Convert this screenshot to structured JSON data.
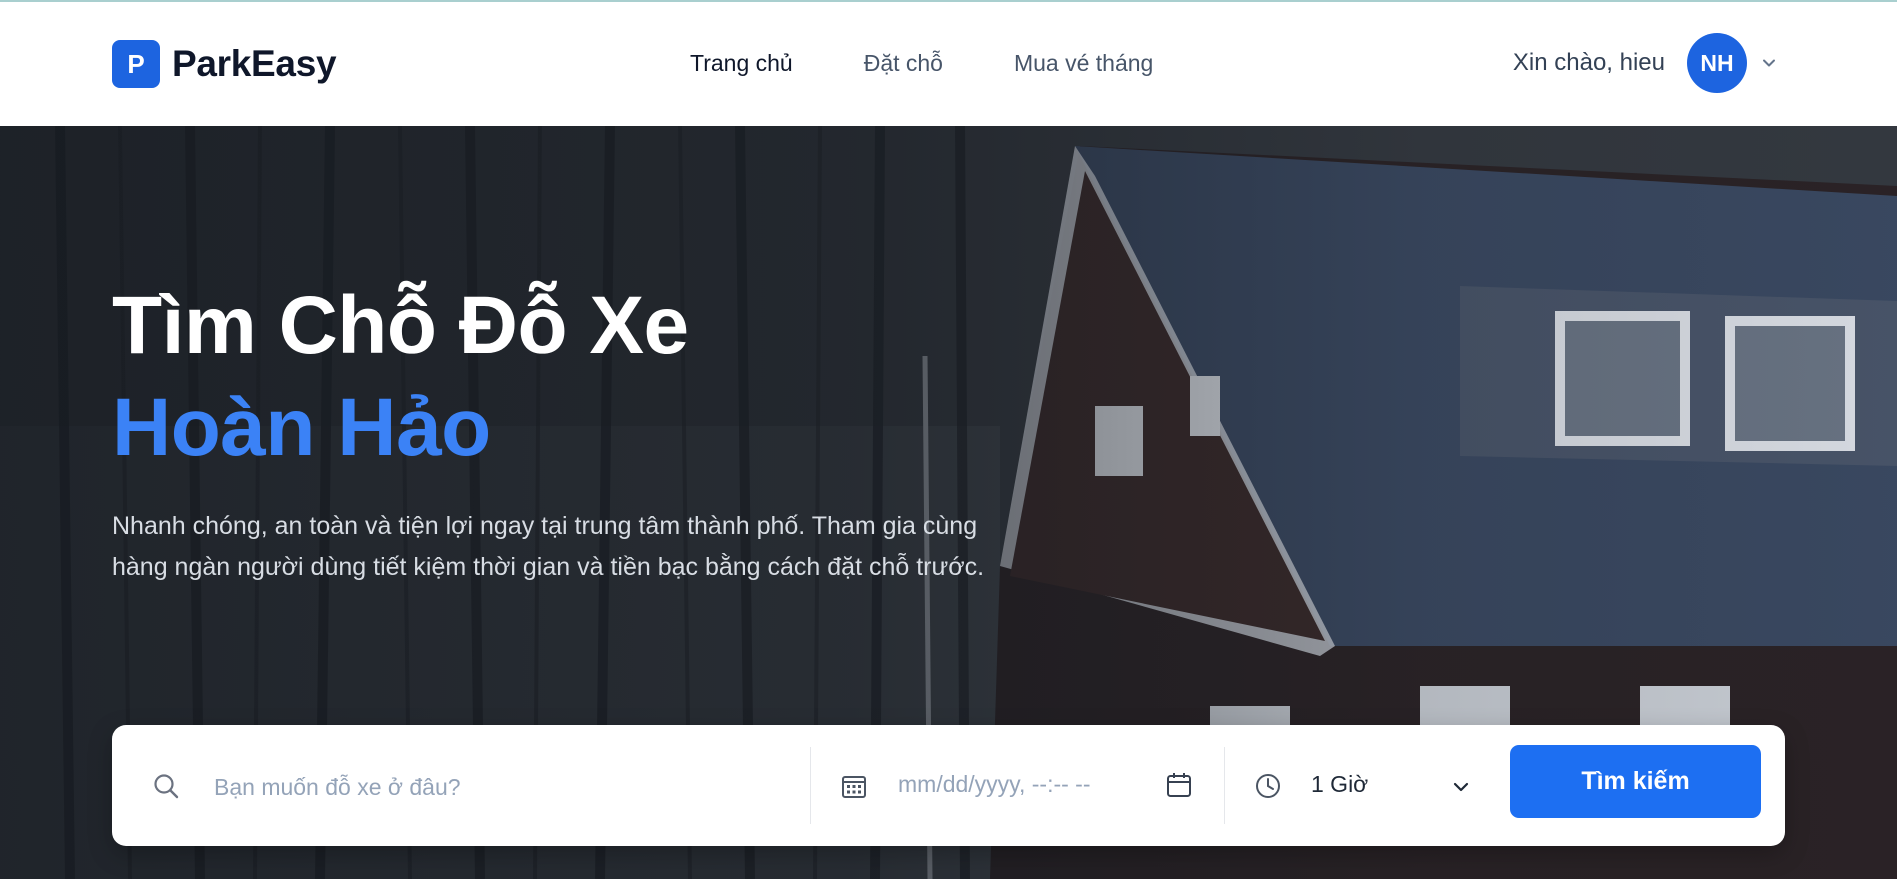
{
  "brand": {
    "logo_letter": "P",
    "name": "ParkEasy",
    "color": "#1d64e0"
  },
  "nav": {
    "items": [
      {
        "label": "Trang chủ",
        "active": true
      },
      {
        "label": "Đặt chỗ",
        "active": false
      },
      {
        "label": "Mua vé tháng",
        "active": false
      }
    ]
  },
  "user": {
    "greeting": "Xin chào, hieu",
    "initials": "NH"
  },
  "hero": {
    "title_line1": "Tìm Chỗ Đỗ Xe",
    "title_line2": "Hoàn Hảo",
    "description": "Nhanh chóng, an toàn và tiện lợi ngay tại trung tâm thành phố. Tham gia cùng hàng ngàn người dùng tiết kiệm thời gian và tiền bạc bằng cách đặt chỗ trước.",
    "accent_color": "#3b82f6"
  },
  "search": {
    "location_placeholder": "Bạn muốn đỗ xe ở đâu?",
    "location_value": "",
    "datetime_placeholder": "mm/dd/yyyy, --:-- --",
    "duration": "1 Giờ",
    "button_label": "Tìm kiếm",
    "button_color": "#1d6ff2"
  },
  "icons": [
    "search-icon",
    "calendar-icon",
    "calendar-picker-icon",
    "clock-icon",
    "chevron-down-icon"
  ]
}
